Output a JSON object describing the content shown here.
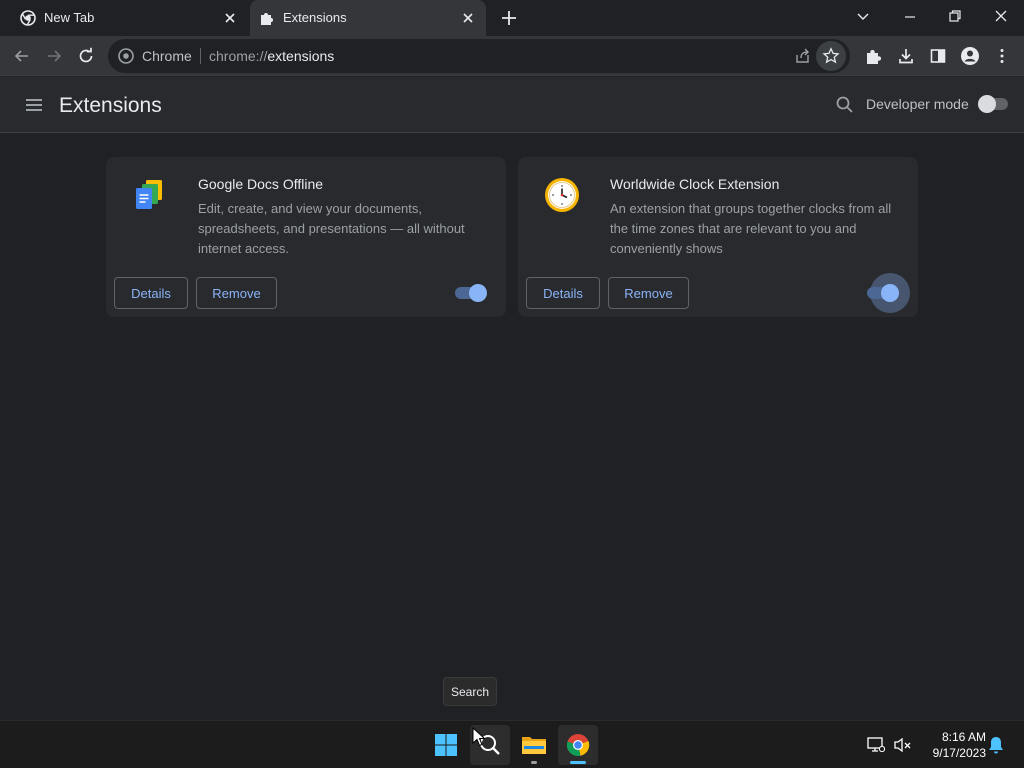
{
  "browser": {
    "tabs": [
      {
        "title": "New Tab",
        "icon": "chrome-icon",
        "active": false
      },
      {
        "title": "Extensions",
        "icon": "puzzle-icon",
        "active": true
      }
    ],
    "omnibox": {
      "site_label": "Chrome",
      "url_scheme": "chrome://",
      "url_path": "extensions"
    }
  },
  "page": {
    "title": "Extensions",
    "developer_mode_label": "Developer mode",
    "developer_mode_enabled": false
  },
  "extensions": [
    {
      "name": "Google Docs Offline",
      "description": "Edit, create, and view your documents, spreadsheets, and presentations — all without internet access.",
      "icon": "google-docs-icon",
      "enabled": true,
      "details_label": "Details",
      "remove_label": "Remove"
    },
    {
      "name": "Worldwide Clock Extension",
      "description": "An extension that groups together clocks from all the time zones that are relevant to you and conveniently shows",
      "icon": "clock-icon",
      "enabled": true,
      "details_label": "Details",
      "remove_label": "Remove"
    }
  ],
  "taskbar": {
    "tooltip": "Search",
    "time": "8:16 AM",
    "date": "9/17/2023"
  },
  "colors": {
    "background": "#202124",
    "accent": "#8ab4f8",
    "card": "#292a2d"
  }
}
